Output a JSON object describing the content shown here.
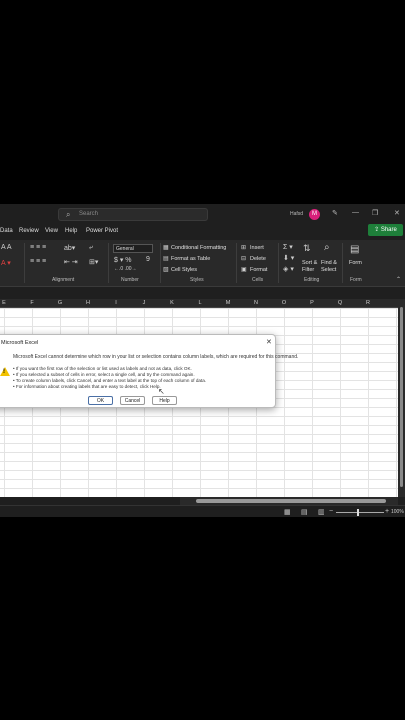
{
  "titlebar": {
    "search_placeholder": "Search",
    "user_name": "Hafsd",
    "avatar_initial": "M",
    "minimize": "—",
    "restore": "❐",
    "close": "✕",
    "pen": "✎"
  },
  "menu": {
    "tabs": [
      "Data",
      "Review",
      "View",
      "Help",
      "Power Pivot"
    ],
    "share": "Share"
  },
  "ribbon": {
    "number_format": "General",
    "conditional_formatting": "Conditional Formatting",
    "format_as_table": "Format as Table",
    "cell_styles": "Cell Styles",
    "insert": "Insert",
    "delete": "Delete",
    "format": "Format",
    "sort_filter": "Sort &",
    "sort_filter2": "Filter",
    "find_select": "Find &",
    "find_select2": "Select",
    "form": "Form",
    "groups": {
      "alignment": "Alignment",
      "number": "Number",
      "styles": "Styles",
      "cells": "Cells",
      "editing": "Editing",
      "form": "Form"
    }
  },
  "columns": [
    "E",
    "F",
    "G",
    "H",
    "I",
    "J",
    "K",
    "L",
    "M",
    "N",
    "O",
    "P",
    "Q",
    "R"
  ],
  "status": {
    "zoom": "100%"
  },
  "dialog": {
    "title": "Microsoft Excel",
    "message": "Microsoft Excel cannot determine which row in your list or selection contains column labels, which are required for this command.",
    "bullets": [
      "• If you want the first row of the selection or list used as labels and not as data, click OK.",
      "• If you selected a subset of cells in error, select a single cell, and try the command again.",
      "• To create column labels, click Cancel, and enter a text label at the top of each column of data.",
      "• For information about creating labels that are easy to detect, click Help."
    ],
    "ok": "OK",
    "cancel": "Cancel",
    "help": "Help",
    "close": "✕"
  }
}
